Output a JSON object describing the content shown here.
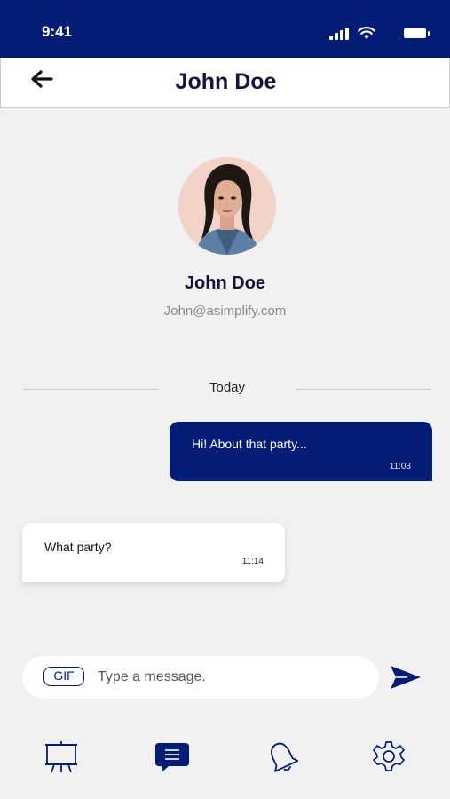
{
  "status_bar": {
    "time": "9:41",
    "icons": [
      "signal-icon",
      "wifi-icon",
      "battery-icon"
    ],
    "background": "#031c75"
  },
  "header": {
    "back_icon": "arrow-left-icon",
    "title": "John Doe"
  },
  "profile": {
    "name": "John Doe",
    "email": "John@asimplify.com"
  },
  "chat": {
    "date_divider": "Today",
    "messages": [
      {
        "direction": "outgoing",
        "text": "Hi! About that party...",
        "time": "11:03"
      },
      {
        "direction": "incoming",
        "text": "What party?",
        "time": "11:14"
      }
    ]
  },
  "composer": {
    "gif_label": "GIF",
    "placeholder": "Type a message.",
    "value": "",
    "send_icon": "send-icon"
  },
  "bottom_nav": {
    "items": [
      {
        "name": "presentation",
        "icon": "easel-icon",
        "active": false
      },
      {
        "name": "messages",
        "icon": "chat-bubble-icon",
        "active": true
      },
      {
        "name": "notifications",
        "icon": "bell-icon",
        "active": false
      },
      {
        "name": "settings",
        "icon": "gear-icon",
        "active": false
      }
    ]
  },
  "colors": {
    "accent": "#031c75",
    "background": "#f1f1f1",
    "bubble_incoming": "#ffffff",
    "muted_text": "#8a8a8a"
  }
}
